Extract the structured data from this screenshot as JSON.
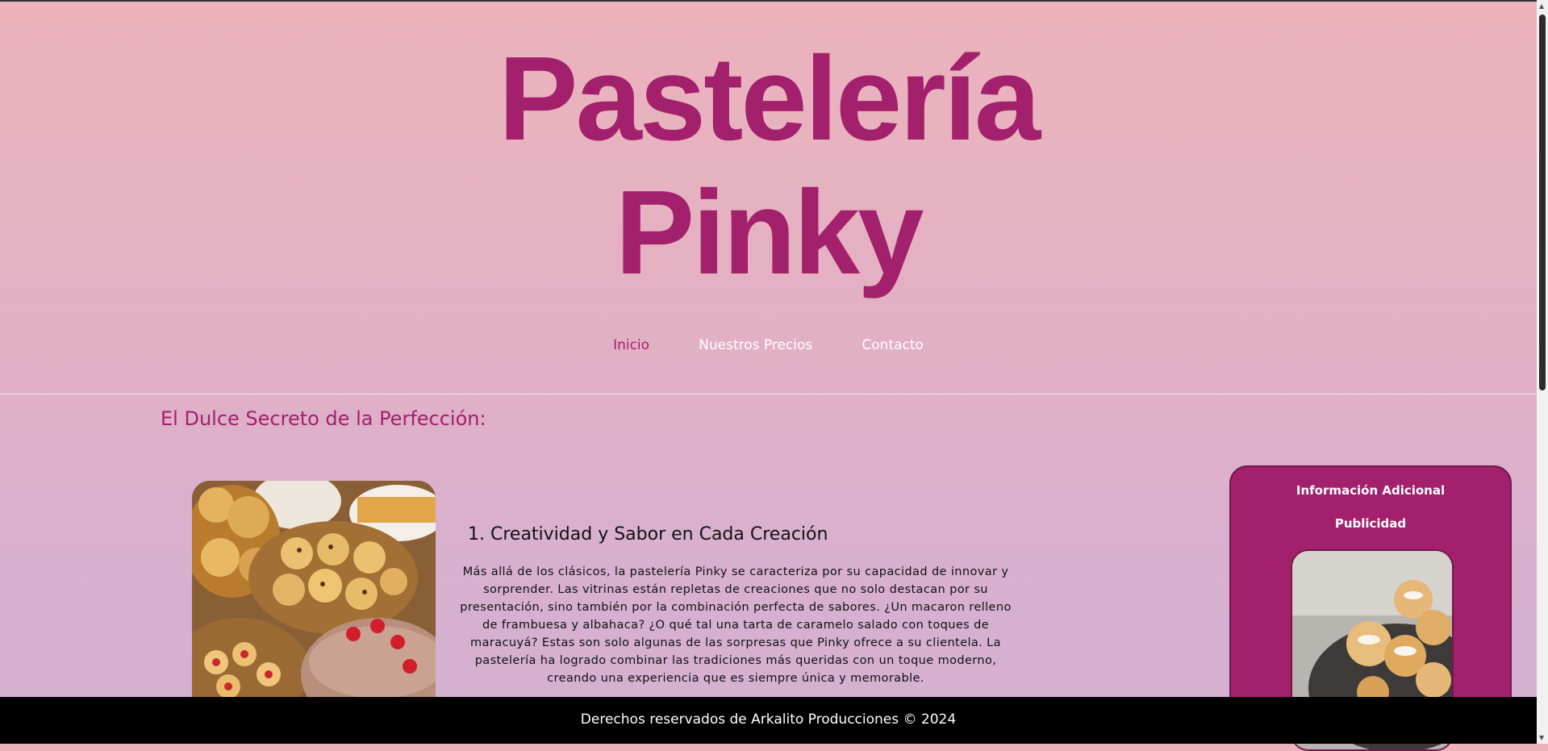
{
  "header": {
    "brand_line1": "Pastelería",
    "brand_line2": "Pinky"
  },
  "nav": {
    "items": [
      {
        "label": "Inicio"
      },
      {
        "label": "Nuestros Precios"
      },
      {
        "label": "Contacto"
      }
    ]
  },
  "main": {
    "section_title": "El Dulce Secreto de la Perfección:",
    "article": {
      "heading": "1. Creatividad y Sabor en Cada Creación",
      "body": "Más allá de los clásicos, la pastelería Pinky se caracteriza por su capacidad de innovar y sorprender. Las vitrinas están repletas de creaciones que no solo destacan por su presentación, sino también por la combinación perfecta de sabores. ¿Un macaron relleno de frambuesa y albahaca? ¿O qué tal una tarta de caramelo salado con toques de maracuyá? Estas son solo algunas de las sorpresas que Pinky ofrece a su clientela. La pastelería ha logrado combinar las tradiciones más queridas con un toque moderno, creando una experiencia que es siempre única y memorable."
    }
  },
  "aside": {
    "title": "Información Adicional",
    "subtitle": "Publicidad"
  },
  "footer": {
    "text": "Derechos reservados de Arkalito Producciones © 2024"
  },
  "colors": {
    "brand": "#a3206c",
    "footer_bg": "#000000",
    "nav_text": "#ffffff"
  }
}
